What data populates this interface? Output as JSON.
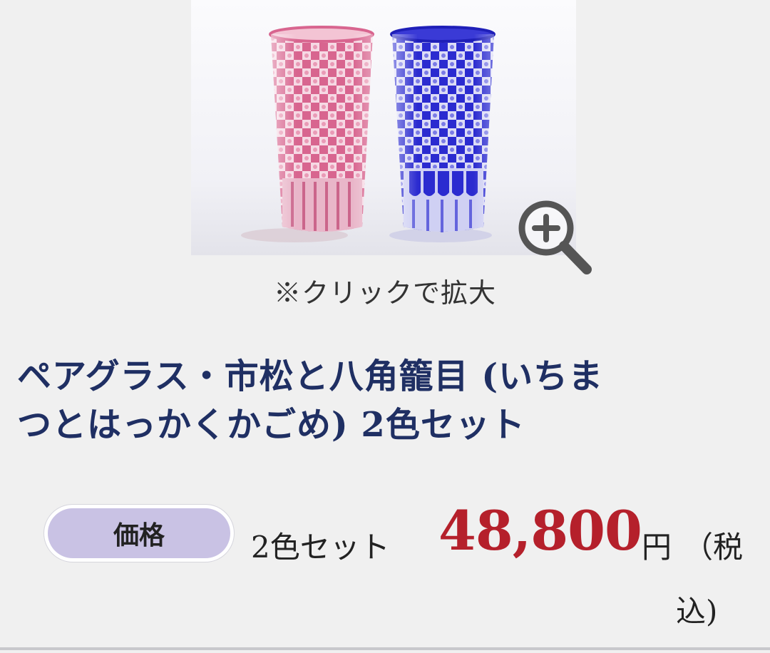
{
  "product_image": {
    "alt": "ペアグラス・市松と八角籠目",
    "caption": "※クリックで拡大"
  },
  "icons": {
    "zoom": "zoom-in-magnifier-icon"
  },
  "product": {
    "title_line1": "ペアグラス・市松と八角籠目 (いちま",
    "title_line2": "つとはっかくかごめ) 2色セット"
  },
  "price": {
    "badge_label": "価格",
    "set_label": "2色セット",
    "amount": "48,800",
    "currency": "円",
    "tax_open": "（税",
    "tax_close": "込)"
  },
  "colors": {
    "title": "#1f2f63",
    "price": "#b5202b",
    "badge_bg": "#c9c2e4",
    "glass_pink": "#d04a7a",
    "glass_blue": "#2a2ad0"
  }
}
